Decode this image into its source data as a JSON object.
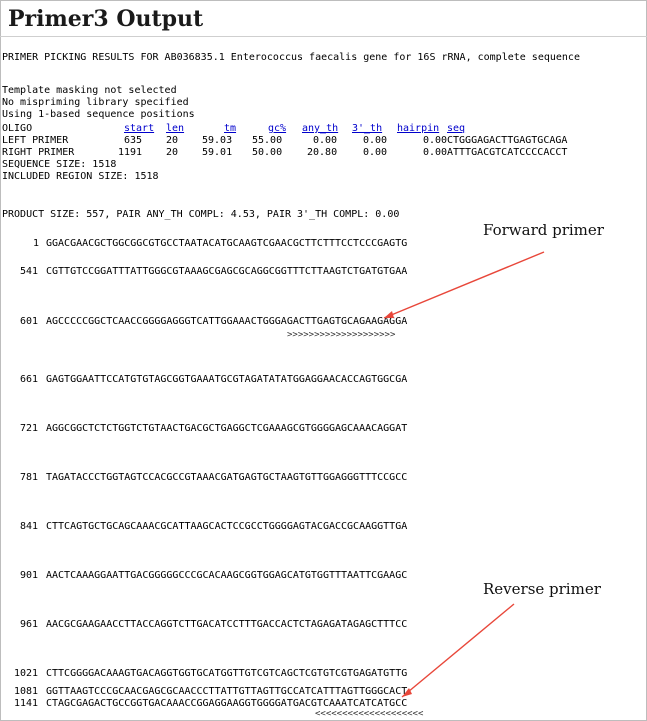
{
  "title": "Primer3 Output",
  "heading": "PRIMER PICKING RESULTS FOR AB036835.1 Enterococcus faecalis gene for 16S rRNA, complete sequence",
  "info_lines": [
    "Template masking not selected",
    "No mispriming library specified",
    "Using 1-based sequence positions"
  ],
  "table": {
    "columns": [
      "OLIGO",
      "start",
      "len",
      "tm",
      "gc%",
      "any_th",
      "3'_th",
      "hairpin",
      "seq"
    ],
    "rows": [
      [
        "LEFT PRIMER",
        "635",
        "20",
        "59.03",
        "55.00",
        "0.00",
        "0.00",
        "0.00",
        "CTGGGAGACTTGAGTGCAGA"
      ],
      [
        "RIGHT PRIMER",
        "1191",
        "20",
        "59.01",
        "50.00",
        "20.80",
        "0.00",
        "0.00",
        "ATTTGACGTCATCCCCACCT"
      ]
    ],
    "sequence_size": "SEQUENCE SIZE: 1518",
    "included_region": "INCLUDED REGION SIZE: 1518"
  },
  "product_line": "PRODUCT SIZE: 557, PAIR ANY_TH COMPL: 4.53, PAIR 3'_TH COMPL: 0.00",
  "sequence_lines": [
    {
      "pos": "1",
      "seq": "GGACGAACGCTGGCGGCGTGCCTAATACATGCAAGTCGAACGCTTCTTTCCTCCCGAGTG"
    },
    {
      "pos": "541",
      "seq": "CGTTGTCCGGATTTATTGGGCGTAAAGCGAGCGCAGGCGGTTTCTTAAGTCTGATGTGAA"
    },
    {
      "pos": "601",
      "seq": "AGCCCCCGGCTCAACCGGGGAGGGTCATTGGAAACTGGGAGACTTGAGTGCAGAAGAGGA"
    },
    {
      "pos": "661",
      "seq": "GAGTGGAATTCCATGTGTAGCGGTGAAATGCGTAGATATATGGAGGAACACCAGTGGCGA"
    },
    {
      "pos": "721",
      "seq": "AGGCGGCTCTCTGGTCTGTAACTGACGCTGAGGCTCGAAAGCGTGGGGAGCAAACAGGAT"
    },
    {
      "pos": "781",
      "seq": "TAGATACCCTGGTAGTCCACGCCGTAAACGATGAGTGCTAAGTGTTGGAGGGTTTCCGCC"
    },
    {
      "pos": "841",
      "seq": "CTTCAGTGCTGCAGCAAACGCATTAAGCACTCCGCCTGGGGAGTACGACCGCAAGGTTGA"
    },
    {
      "pos": "901",
      "seq": "AACTCAAAGGAATTGACGGGGGCCCGCACAAGCGGTGGAGCATGTGGTTTAATTCGAAGC"
    },
    {
      "pos": "961",
      "seq": "AACGCGAAGAACCTTACCAGGTCTTGACATCCTTTGACCACTCTAGAGATAGAGCTTTCC"
    },
    {
      "pos": "1021",
      "seq": "CTTCGGGGACAAAGTGACAGGTGGTGCATGGTTGTCGTCAGCTCGTGTCGTGAGATGTTG"
    },
    {
      "pos": "1081",
      "seq": "GGTTAAGTCCCGCAACGAGCGCAACCCTTATTGTTAGTTGCCATCATTTAGTTGGGCACT"
    },
    {
      "pos": "1141",
      "seq": "CTAGCGAGACTGCCGGTGACAAACCGGAGGAAGGTGGGGATGACGTCAAATCATCATGCC"
    }
  ],
  "forward_marks": ">>>>>>>>>>>>>>>>>>>>",
  "reverse_marks": "<<<<<<<<<<<<<<<<<<<<",
  "annotations": {
    "forward": "Forward primer",
    "reverse": "Reverse primer"
  },
  "colors": {
    "arrow": "#e8473a",
    "link": "#0000cc"
  }
}
